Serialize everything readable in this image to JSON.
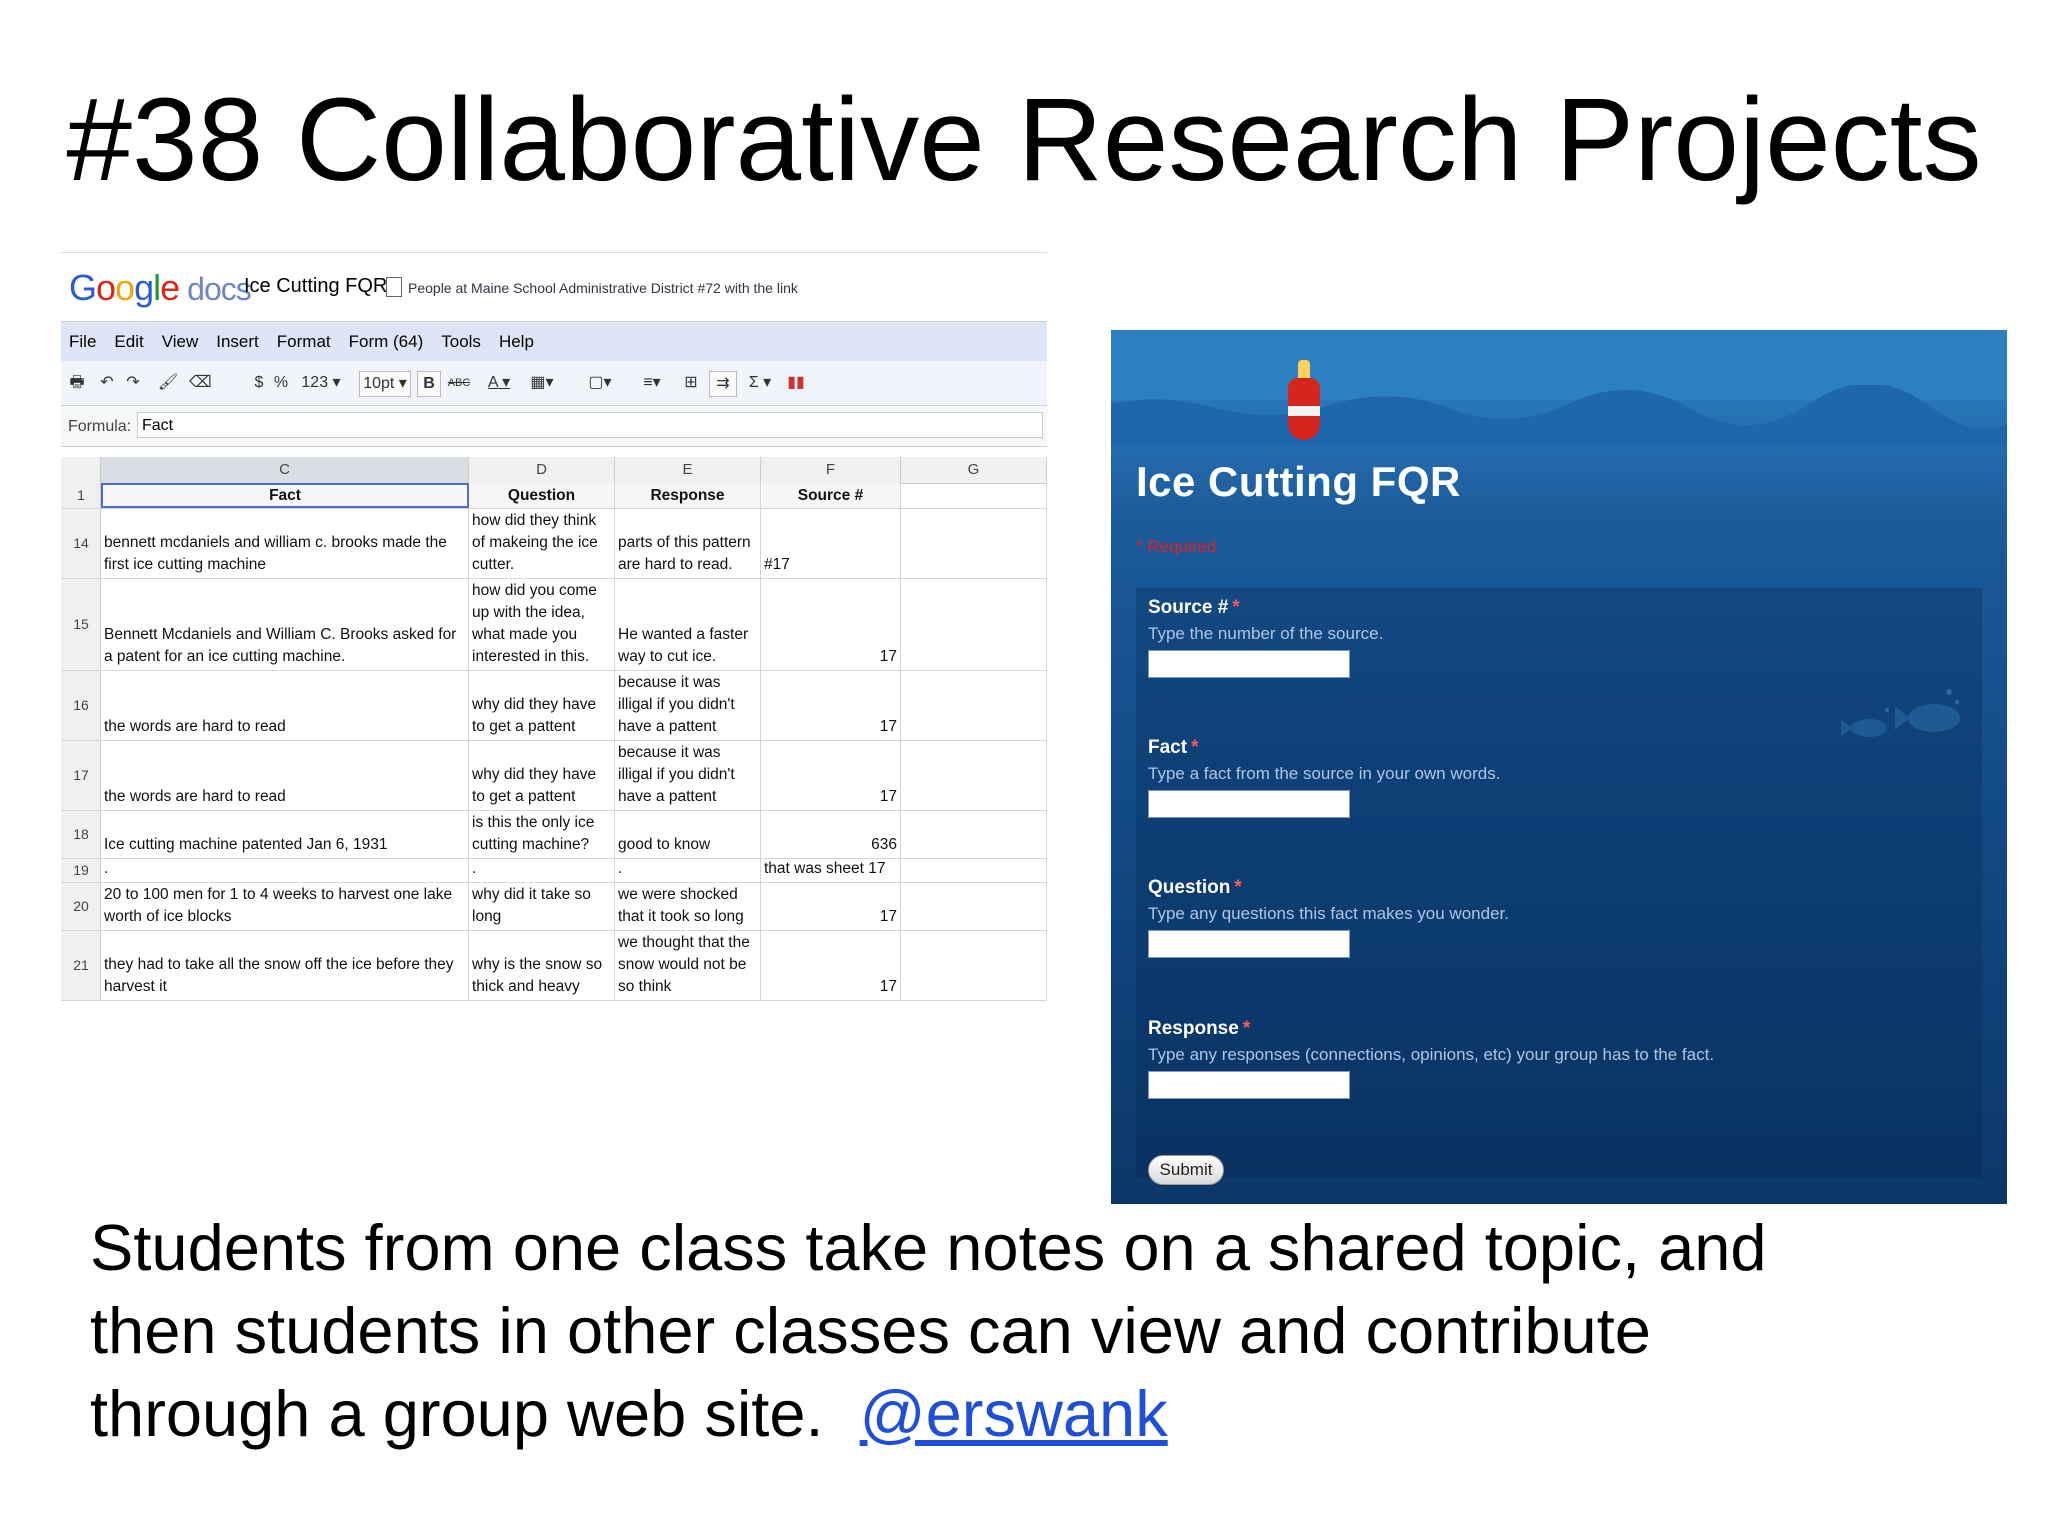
{
  "slide": {
    "title": "#38 Collaborative Research Projects",
    "caption_line1": "Students from one class take notes on a shared topic, and",
    "caption_line2": "then students in other classes can view and contribute",
    "caption_line3": "through a group web site.",
    "caption_handle": "@erswank"
  },
  "spreadsheet": {
    "logo_g1": "G",
    "logo_g2": "o",
    "logo_g3": "o",
    "logo_g4": "g",
    "logo_g5": "l",
    "logo_g6": "e",
    "logo_docs": "docs",
    "doc_title": "Ice Cutting FQR",
    "share_note": "People at Maine School Administrative District #72 with the link",
    "menu": [
      "File",
      "Edit",
      "View",
      "Insert",
      "Format",
      "Form (64)",
      "Tools",
      "Help"
    ],
    "toolbar": {
      "currency": "$",
      "percent": "%",
      "number_format": "123 ▾",
      "font_size": "10pt ▾",
      "bold": "B",
      "strike": "ABC",
      "text_color": "A ▾",
      "sum": "Σ ▾"
    },
    "formula_label": "Formula:",
    "formula_value": "Fact",
    "columns": [
      "C",
      "D",
      "E",
      "F",
      "G"
    ],
    "header_row": {
      "num": "1",
      "fact": "Fact",
      "question": "Question",
      "response": "Response",
      "source": "Source #"
    },
    "rows": [
      {
        "num": "14",
        "fact": "bennett mcdaniels and william c. brooks made the first ice cutting machine",
        "question": "how did they think of makeing the ice cutter.",
        "response": "parts of this pattern are hard to read.",
        "source": "#17",
        "source_left": true
      },
      {
        "num": "15",
        "fact": "Bennett Mcdaniels and William C. Brooks asked for a patent for an ice cutting machine.",
        "question": "how did you come up with the idea, what made you interested in this.",
        "response": "He wanted a faster way to cut ice.",
        "source": "17"
      },
      {
        "num": "16",
        "fact": "the words are hard to read",
        "question": "why did they have to get a pattent",
        "response": "because it was illigal if you didn't have a pattent",
        "source": "17"
      },
      {
        "num": "17",
        "fact": "the words are hard to read",
        "question": "why did they have to get a pattent",
        "response": "because it was illigal if you didn't have a pattent",
        "source": "17"
      },
      {
        "num": "18",
        "fact": "Ice cutting machine patented Jan 6, 1931",
        "question": "is this the only ice cutting machine?",
        "response": "good to know",
        "source": "636"
      },
      {
        "num": "19",
        "fact": ".",
        "question": ".",
        "response": ".",
        "source": "that was sheet 17",
        "source_left": true
      },
      {
        "num": "20",
        "fact": "20 to 100 men for 1 to 4 weeks to harvest one lake worth of ice blocks",
        "question": "why did it take so long",
        "response": "we were shocked that it took so long",
        "source": "17"
      },
      {
        "num": "21",
        "fact": "they had to take all the snow off the ice before they harvest it",
        "question": "why is the snow so thick and heavy",
        "response": "we thought that the snow would not be so think",
        "source": "17"
      }
    ]
  },
  "form": {
    "title": "Ice Cutting FQR",
    "required_note": "* Required",
    "required_mark": "*",
    "questions": [
      {
        "label": "Source #",
        "help": "Type the number of the source.",
        "value": ""
      },
      {
        "label": "Fact",
        "help": "Type a fact from the source in your own words.",
        "value": ""
      },
      {
        "label": "Question",
        "help": "Type any questions this fact makes you wonder.",
        "value": ""
      },
      {
        "label": "Response",
        "help": "Type any responses (connections, opinions, etc) your group has to the fact.",
        "value": ""
      }
    ],
    "submit_label": "Submit"
  }
}
